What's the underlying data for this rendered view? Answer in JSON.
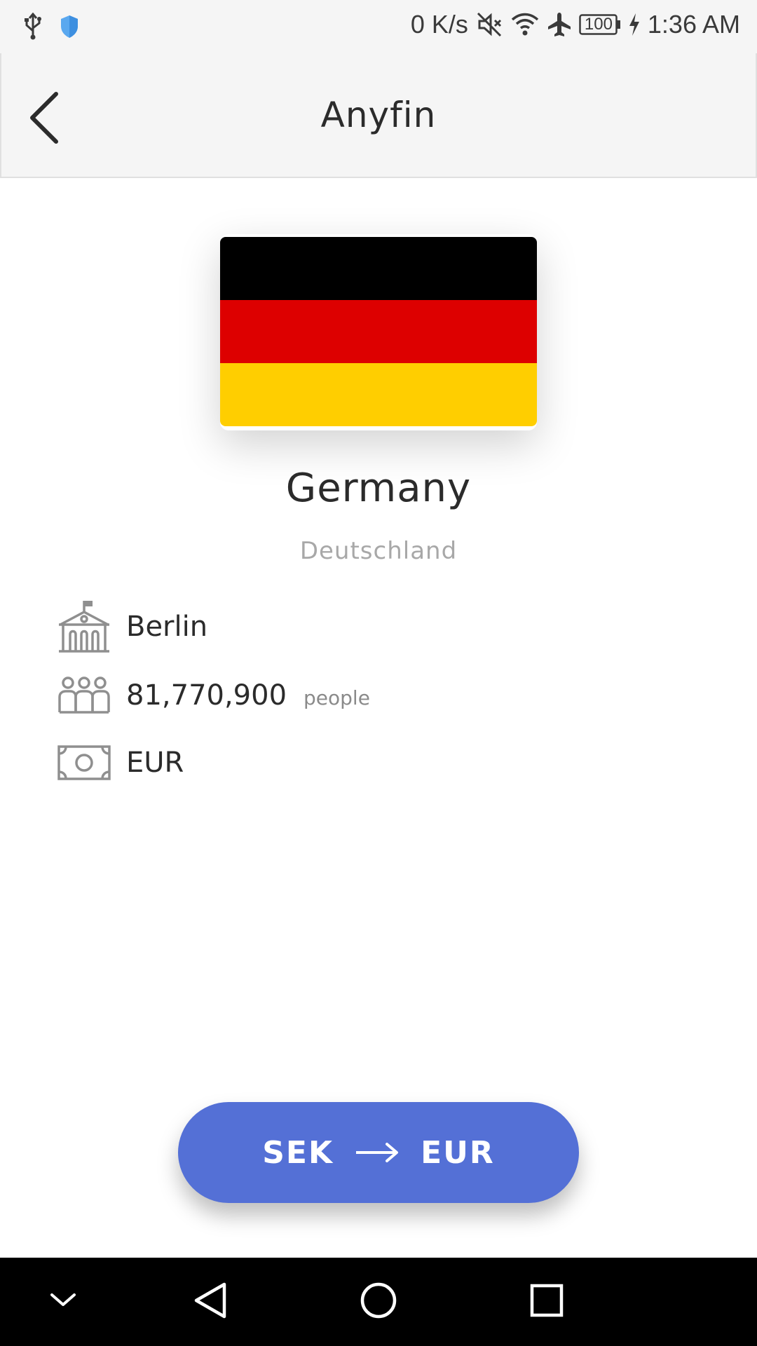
{
  "status_bar": {
    "net_speed": "0 K/s",
    "battery": "100",
    "time": "1:36 AM",
    "icons": [
      "usb-icon",
      "shield-icon",
      "mute-icon",
      "wifi-icon",
      "airplane-icon",
      "battery-icon",
      "charging-icon"
    ]
  },
  "app_bar": {
    "title": "Anyfin",
    "back_icon": "chevron-left-icon"
  },
  "country": {
    "name": "Germany",
    "native_name": "Deutschland",
    "flag_colors": [
      "#000000",
      "#dd0000",
      "#ffce00"
    ]
  },
  "info": {
    "capital": "Berlin",
    "population": "81,770,900",
    "population_unit": "people",
    "currency": "EUR",
    "icons": [
      "capital-building-icon",
      "people-icon",
      "banknote-icon"
    ]
  },
  "convert_button": {
    "from": "SEK",
    "to": "EUR",
    "arrow_icon": "arrow-right-icon",
    "color": "#5470d6"
  },
  "nav_bar": {
    "icons": [
      "collapse-icon",
      "back-triangle-icon",
      "home-circle-icon",
      "recents-square-icon"
    ]
  }
}
